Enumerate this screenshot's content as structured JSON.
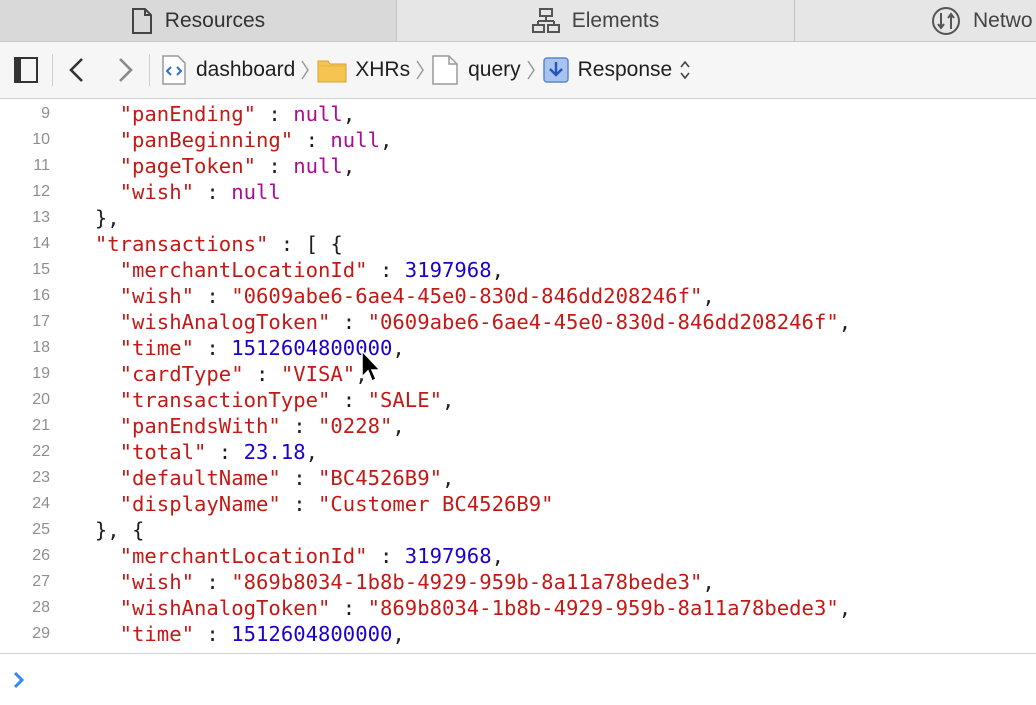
{
  "tabs": [
    {
      "label": "Resources",
      "icon": "document-icon"
    },
    {
      "label": "Elements",
      "icon": "elements-icon"
    },
    {
      "label": "Netwo",
      "icon": "network-icon"
    }
  ],
  "breadcrumb": {
    "items": [
      {
        "label": "dashboard",
        "icon": "html-file-icon"
      },
      {
        "label": "XHRs",
        "icon": "folder-icon"
      },
      {
        "label": "query",
        "icon": "document-icon"
      },
      {
        "label": "Response",
        "icon": "response-download-icon"
      }
    ]
  },
  "code": {
    "lines": [
      {
        "n": "9",
        "indent": 4,
        "key": "\"panEnding\"",
        "sep": " : ",
        "val": "null",
        "vt": "nl",
        "end": ","
      },
      {
        "n": "10",
        "indent": 4,
        "key": "\"panBeginning\"",
        "sep": " : ",
        "val": "null",
        "vt": "nl",
        "end": ","
      },
      {
        "n": "11",
        "indent": 4,
        "key": "\"pageToken\"",
        "sep": " : ",
        "val": "null",
        "vt": "nl",
        "end": ","
      },
      {
        "n": "12",
        "indent": 4,
        "key": "\"wish\"",
        "sep": " : ",
        "val": "null",
        "vt": "nl",
        "end": ""
      },
      {
        "n": "13",
        "indent": 2,
        "key": "",
        "sep": "",
        "val": "",
        "vt": "p",
        "end": "},"
      },
      {
        "n": "14",
        "indent": 2,
        "key": "\"transactions\"",
        "sep": " : ",
        "val": "",
        "vt": "p",
        "end": "[ {"
      },
      {
        "n": "15",
        "indent": 4,
        "key": "\"merchantLocationId\"",
        "sep": " : ",
        "val": "3197968",
        "vt": "n",
        "end": ","
      },
      {
        "n": "16",
        "indent": 4,
        "key": "\"wish\"",
        "sep": " : ",
        "val": "\"0609abe6-6ae4-45e0-830d-846dd208246f\"",
        "vt": "s",
        "end": ","
      },
      {
        "n": "17",
        "indent": 4,
        "key": "\"wishAnalogToken\"",
        "sep": " : ",
        "val": "\"0609abe6-6ae4-45e0-830d-846dd208246f\"",
        "vt": "s",
        "end": ","
      },
      {
        "n": "18",
        "indent": 4,
        "key": "\"time\"",
        "sep": " : ",
        "val": "1512604800000",
        "vt": "n",
        "end": ","
      },
      {
        "n": "19",
        "indent": 4,
        "key": "\"cardType\"",
        "sep": " : ",
        "val": "\"VISA\"",
        "vt": "s",
        "end": ","
      },
      {
        "n": "20",
        "indent": 4,
        "key": "\"transactionType\"",
        "sep": " : ",
        "val": "\"SALE\"",
        "vt": "s",
        "end": ","
      },
      {
        "n": "21",
        "indent": 4,
        "key": "\"panEndsWith\"",
        "sep": " : ",
        "val": "\"0228\"",
        "vt": "s",
        "end": ","
      },
      {
        "n": "22",
        "indent": 4,
        "key": "\"total\"",
        "sep": " : ",
        "val": "23.18",
        "vt": "n",
        "end": ","
      },
      {
        "n": "23",
        "indent": 4,
        "key": "\"defaultName\"",
        "sep": " : ",
        "val": "\"BC4526B9\"",
        "vt": "s",
        "end": ","
      },
      {
        "n": "24",
        "indent": 4,
        "key": "\"displayName\"",
        "sep": " : ",
        "val": "\"Customer BC4526B9\"",
        "vt": "s",
        "end": ""
      },
      {
        "n": "25",
        "indent": 2,
        "key": "",
        "sep": "",
        "val": "",
        "vt": "p",
        "end": "}, {"
      },
      {
        "n": "26",
        "indent": 4,
        "key": "\"merchantLocationId\"",
        "sep": " : ",
        "val": "3197968",
        "vt": "n",
        "end": ","
      },
      {
        "n": "27",
        "indent": 4,
        "key": "\"wish\"",
        "sep": " : ",
        "val": "\"869b8034-1b8b-4929-959b-8a11a78bede3\"",
        "vt": "s",
        "end": ","
      },
      {
        "n": "28",
        "indent": 4,
        "key": "\"wishAnalogToken\"",
        "sep": " : ",
        "val": "\"869b8034-1b8b-4929-959b-8a11a78bede3\"",
        "vt": "s",
        "end": ","
      },
      {
        "n": "29",
        "indent": 4,
        "key": "\"time\"",
        "sep": " : ",
        "val": "1512604800000",
        "vt": "n",
        "end": ","
      }
    ]
  },
  "console": {
    "prompt_icon": "chevron-right-icon",
    "value": ""
  },
  "colors": {
    "string": "#c41a16",
    "number": "#1c00cf",
    "null": "#aa0d91",
    "prompt": "#2f8cf0"
  }
}
